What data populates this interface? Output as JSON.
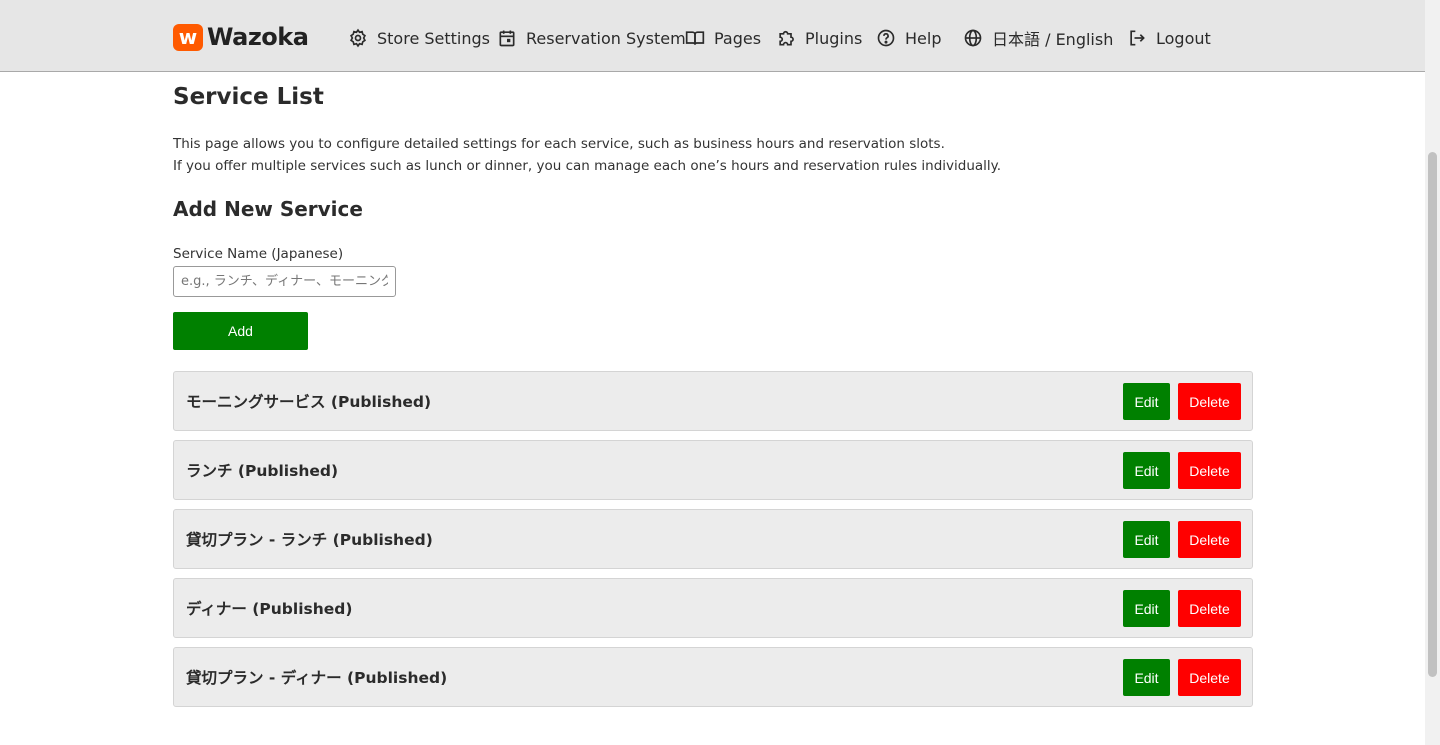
{
  "header": {
    "logo_mark": "w",
    "logo_text": "Wazoka",
    "nav": [
      {
        "label": "Store Settings",
        "icon": "gear-icon"
      },
      {
        "label": "Reservation System",
        "icon": "calendar-icon"
      },
      {
        "label": "Pages",
        "icon": "book-icon"
      },
      {
        "label": "Plugins",
        "icon": "puzzle-icon"
      },
      {
        "label": "Help",
        "icon": "help-icon"
      },
      {
        "label": "日本語 / English",
        "icon": "globe-icon"
      },
      {
        "label": "Logout",
        "icon": "logout-icon"
      }
    ]
  },
  "main": {
    "title": "Service List",
    "description_line1": "This page allows you to configure detailed settings for each service, such as business hours and reservation slots.",
    "description_line2": "If you offer multiple services such as lunch or dinner, you can manage each one’s hours and reservation rules individually.",
    "add_section_title": "Add New Service",
    "service_name_label": "Service Name (Japanese)",
    "service_name_placeholder": "e.g., ランチ、ディナー、モーニング",
    "service_name_value": "",
    "add_button": "Add",
    "edit_label": "Edit",
    "delete_label": "Delete",
    "services": [
      {
        "name": "モーニングサービス (Published)"
      },
      {
        "name": "ランチ (Published)"
      },
      {
        "name": "貸切プラン - ランチ (Published)"
      },
      {
        "name": "ディナー (Published)"
      },
      {
        "name": "貸切プラン - ディナー (Published)"
      }
    ]
  },
  "colors": {
    "brand": "#ff5a00",
    "primary_button": "#008000",
    "danger_button": "#ff0000",
    "header_bg": "#e6e6e6"
  }
}
